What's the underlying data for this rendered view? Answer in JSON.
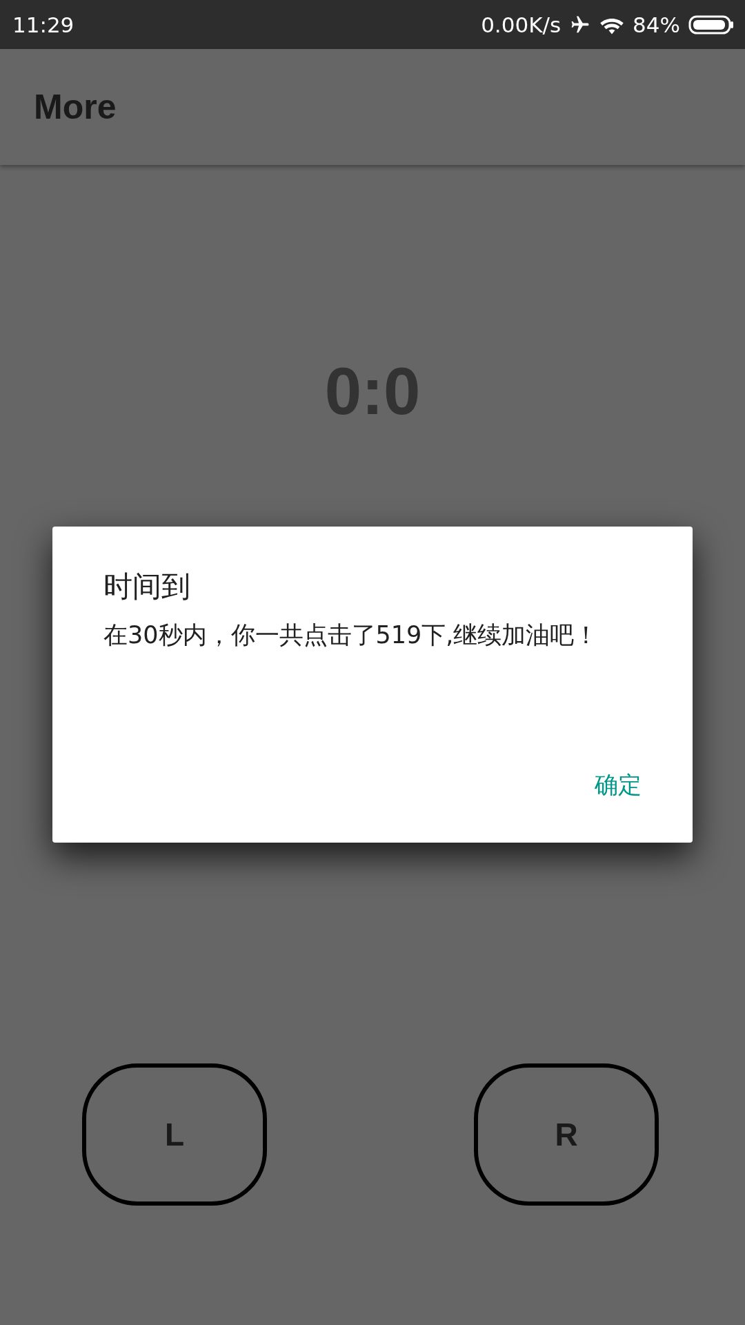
{
  "status_bar": {
    "time": "11:29",
    "network_speed": "0.00K/s",
    "battery": "84%"
  },
  "app_bar": {
    "title": "More"
  },
  "score": "0:0",
  "dialog": {
    "title": "时间到",
    "message": "在30秒内，你一共点击了519下,继续加油吧！",
    "button": "确定"
  },
  "buttons": [
    {
      "label": "L"
    },
    {
      "label": "R"
    }
  ]
}
